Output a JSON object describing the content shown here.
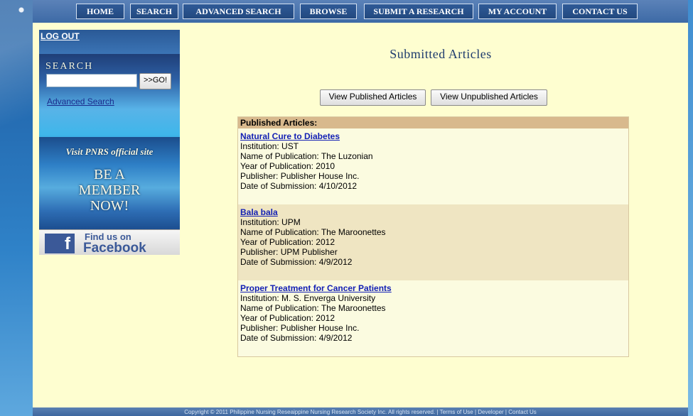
{
  "nav": {
    "items": [
      {
        "label": "HOME"
      },
      {
        "label": "SEARCH"
      },
      {
        "label": "ADVANCED SEARCH"
      },
      {
        "label": "BROWSE"
      },
      {
        "label": "SUBMIT A RESEARCH"
      },
      {
        "label": "MY ACCOUNT"
      },
      {
        "label": "CONTACT US"
      }
    ]
  },
  "sidebar": {
    "logout_label": "LOG OUT",
    "search_title": "SEARCH",
    "search_value": "",
    "go_label": ">>GO!",
    "advanced_search_label": "Advanced Search",
    "banner_visit": "Visit PNRS official site",
    "banner_line1": "BE A",
    "banner_line2": "MEMBER",
    "banner_line3": "NOW!",
    "facebook_find": "Find us on",
    "facebook_name": "Facebook",
    "facebook_glyph": "f"
  },
  "main": {
    "title": "Submitted Articles",
    "view_published_label": "View Published Articles",
    "view_unpublished_label": "View Unpublished Articles",
    "list_header": "Published Articles:",
    "articles": [
      {
        "title": "Natural Cure to Diabetes",
        "institution": "Institution: UST",
        "publication": "Name of Publication: The Luzonian",
        "year": "Year of Publication: 2010",
        "publisher": "Publisher: Publisher House Inc.",
        "date": "Date of Submission: 4/10/2012"
      },
      {
        "title": "Bala bala",
        "institution": "Institution: UPM",
        "publication": "Name of Publication: The Maroonettes",
        "year": "Year of Publication: 2012",
        "publisher": "Publisher: UPM Publisher",
        "date": "Date of Submission: 4/9/2012"
      },
      {
        "title": "Proper Treatment for Cancer Patients",
        "institution": "Institution: M. S. Enverga University",
        "publication": "Name of Publication: The Maroonettes",
        "year": "Year of Publication: 2012",
        "publisher": "Publisher: Publisher House Inc.",
        "date": "Date of Submission: 4/9/2012"
      }
    ]
  },
  "footer": {
    "text": "Copyright © 2011 Philippine Nursing Reseaippine Nursing Research Society Inc. All rights reserved. | Terms of Use | Developer | Contact Us"
  },
  "colors": {
    "panel_bg": "#fefed0",
    "nav_bg": "#3d6aa6",
    "link": "#1320b4",
    "header_tan": "#d8b98d",
    "row_alt": "#efe5c2"
  }
}
